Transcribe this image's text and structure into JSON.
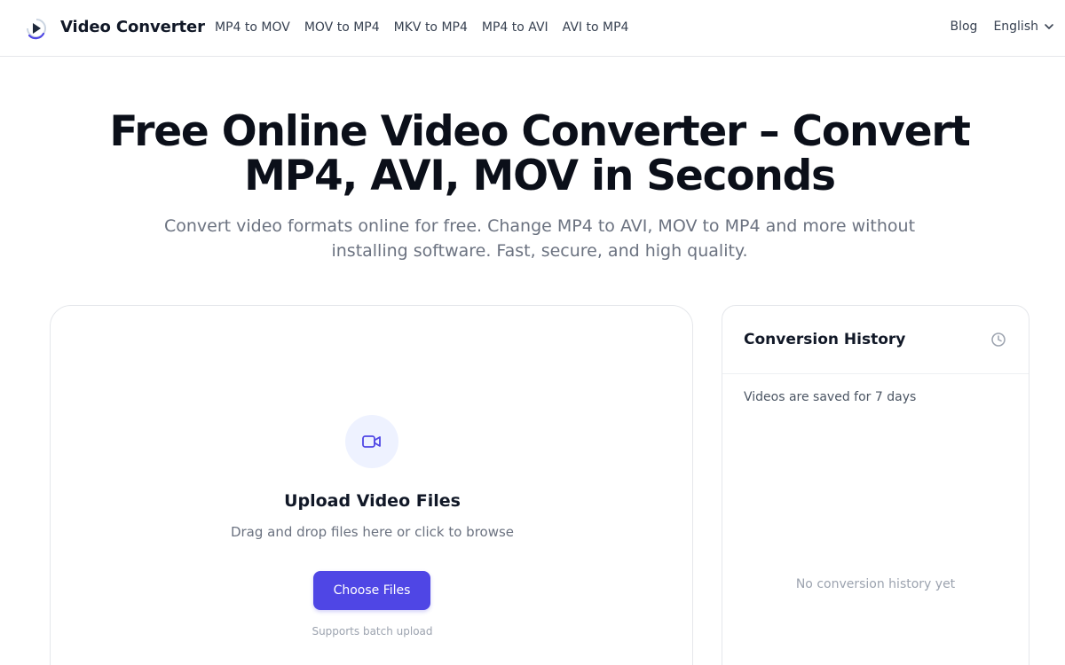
{
  "header": {
    "brand": "Video Converter",
    "nav": [
      "MP4 to MOV",
      "MOV to MP4",
      "MKV to MP4",
      "MP4 to AVI",
      "AVI to MP4"
    ],
    "blog": "Blog",
    "language": "English",
    "accent_color": "#4f46e5"
  },
  "hero": {
    "title": "Free Online Video Converter – Convert MP4, AVI, MOV in Seconds",
    "subtitle": "Convert video formats online for free. Change MP4 to AVI, MOV to MP4 and more without installing software. Fast, secure, and high quality."
  },
  "upload": {
    "icon": "video-camera-icon",
    "title": "Upload Video Files",
    "description": "Drag and drop files here or click to browse",
    "button_label": "Choose Files",
    "note": "Supports batch upload"
  },
  "history": {
    "title": "Conversion History",
    "icon": "clock-icon",
    "note": "Videos are saved for 7 days",
    "empty_text": "No conversion history yet"
  }
}
